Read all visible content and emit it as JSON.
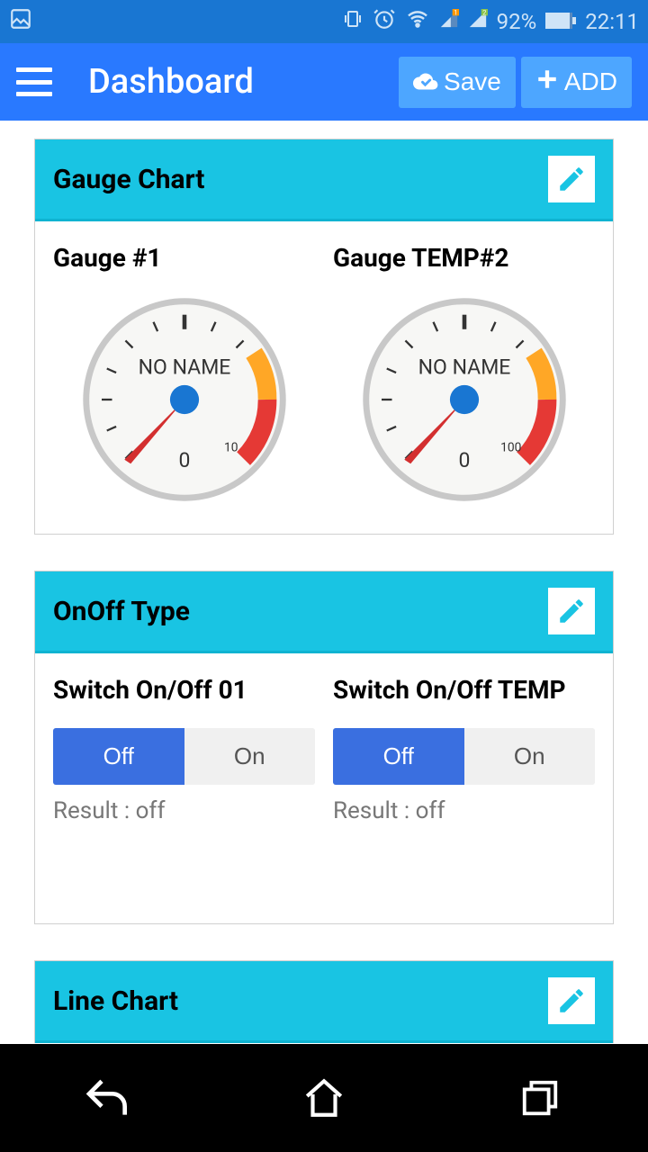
{
  "status": {
    "battery": "92%",
    "time": "22:11"
  },
  "appbar": {
    "title": "Dashboard",
    "save": "Save",
    "add": "ADD"
  },
  "cards": {
    "gauge": {
      "title": "Gauge Chart",
      "g1": {
        "title": "Gauge #1",
        "label": "NO NAME",
        "min": "0",
        "max": "10"
      },
      "g2": {
        "title": "Gauge TEMP#2",
        "label": "NO NAME",
        "min": "0",
        "max": "100"
      }
    },
    "onoff": {
      "title": "OnOff Type",
      "s1": {
        "title": "Switch On/Off 01",
        "off": "Off",
        "on": "On",
        "result": "Result : off"
      },
      "s2": {
        "title": "Switch On/Off TEMP",
        "off": "Off",
        "on": "On",
        "result": "Result : off"
      }
    },
    "line": {
      "title": "Line Chart"
    }
  },
  "chart_data": [
    {
      "type": "gauge",
      "title": "Gauge #1",
      "label": "NO NAME",
      "min": 0,
      "max": 10,
      "value": 0,
      "warn_start": 6,
      "danger_start": 8
    },
    {
      "type": "gauge",
      "title": "Gauge TEMP#2",
      "label": "NO NAME",
      "min": 0,
      "max": 100,
      "value": 0,
      "warn_start": 60,
      "danger_start": 80
    }
  ]
}
